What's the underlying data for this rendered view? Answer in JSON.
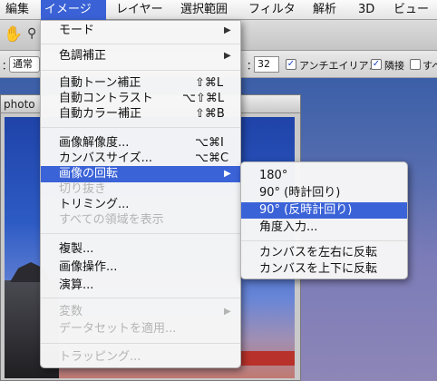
{
  "menubar": {
    "items": [
      "編集",
      "イメージ",
      "レイヤー",
      "選択範囲",
      "フィルタ",
      "解析",
      "3D",
      "ビュー"
    ]
  },
  "options_bar": {
    "style_label": "：",
    "style_value": "通常",
    "size_label": "：",
    "size_value": "32",
    "antialias_label": "アンチエイリアス",
    "adjacent_label": "隣接",
    "all_layers_label": "すべ"
  },
  "document": {
    "title": "photo"
  },
  "image_menu": {
    "items": [
      {
        "label": "モード",
        "shortcut": "",
        "submenu": true,
        "disabled": false
      },
      {
        "label": "色調補正",
        "shortcut": "",
        "submenu": true,
        "disabled": false
      },
      {
        "label": "自動トーン補正",
        "shortcut": "⇧⌘L",
        "submenu": false,
        "disabled": false
      },
      {
        "label": "自動コントラスト",
        "shortcut": "⌥⇧⌘L",
        "submenu": false,
        "disabled": false
      },
      {
        "label": "自動カラー補正",
        "shortcut": "⇧⌘B",
        "submenu": false,
        "disabled": false
      },
      {
        "label": "画像解像度...",
        "shortcut": "⌥⌘I",
        "submenu": false,
        "disabled": false
      },
      {
        "label": "カンバスサイズ...",
        "shortcut": "⌥⌘C",
        "submenu": false,
        "disabled": false
      },
      {
        "label": "画像の回転",
        "shortcut": "",
        "submenu": true,
        "disabled": false,
        "highlighted": true
      },
      {
        "label": "切り抜き",
        "shortcut": "",
        "submenu": false,
        "disabled": true
      },
      {
        "label": "トリミング...",
        "shortcut": "",
        "submenu": false,
        "disabled": false
      },
      {
        "label": "すべての領域を表示",
        "shortcut": "",
        "submenu": false,
        "disabled": true
      },
      {
        "label": "複製...",
        "shortcut": "",
        "submenu": false,
        "disabled": false
      },
      {
        "label": "画像操作...",
        "shortcut": "",
        "submenu": false,
        "disabled": false
      },
      {
        "label": "演算...",
        "shortcut": "",
        "submenu": false,
        "disabled": false
      },
      {
        "label": "変数",
        "shortcut": "",
        "submenu": true,
        "disabled": true
      },
      {
        "label": "データセットを適用...",
        "shortcut": "",
        "submenu": false,
        "disabled": true
      },
      {
        "label": "トラッピング...",
        "shortcut": "",
        "submenu": false,
        "disabled": true
      }
    ]
  },
  "rotate_submenu": {
    "items": [
      {
        "label": "180°",
        "highlighted": false
      },
      {
        "label": "90° (時計回り)",
        "highlighted": false
      },
      {
        "label": "90° (反時計回り)",
        "highlighted": true
      },
      {
        "label": "角度入力...",
        "highlighted": false
      },
      {
        "label": "カンバスを左右に反転",
        "highlighted": false
      },
      {
        "label": "カンバスを上下に反転",
        "highlighted": false
      }
    ]
  },
  "colors": {
    "menu_highlight": "#3b63d8",
    "disabled_text": "#b4b4b4"
  }
}
